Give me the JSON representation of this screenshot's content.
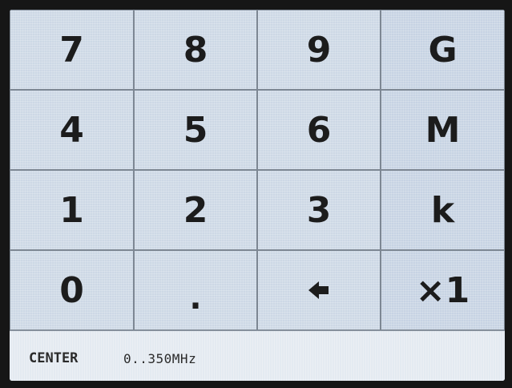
{
  "keypad": {
    "rows": [
      [
        "7",
        "8",
        "9",
        "G"
      ],
      [
        "4",
        "5",
        "6",
        "M"
      ],
      [
        "1",
        "2",
        "3",
        "k"
      ],
      [
        "0",
        ".",
        "backspace-arrow-icon",
        "×1"
      ]
    ],
    "key_7": "7",
    "key_8": "8",
    "key_9": "9",
    "key_G": "G",
    "key_4": "4",
    "key_5": "5",
    "key_6": "6",
    "key_M": "M",
    "key_1": "1",
    "key_2": "2",
    "key_3": "3",
    "key_k": "k",
    "key_0": "0",
    "key_dot": ".",
    "key_backspace_icon": "backspace-arrow-icon",
    "key_x1": "×1"
  },
  "status": {
    "parameter": "CENTER",
    "range": "0..350MHz"
  },
  "colors": {
    "key_background": "#cdd8e5",
    "key_border": "#7d8793",
    "text": "#1c1c1c",
    "status_background": "#e4eaf1",
    "bezel": "#161616"
  }
}
